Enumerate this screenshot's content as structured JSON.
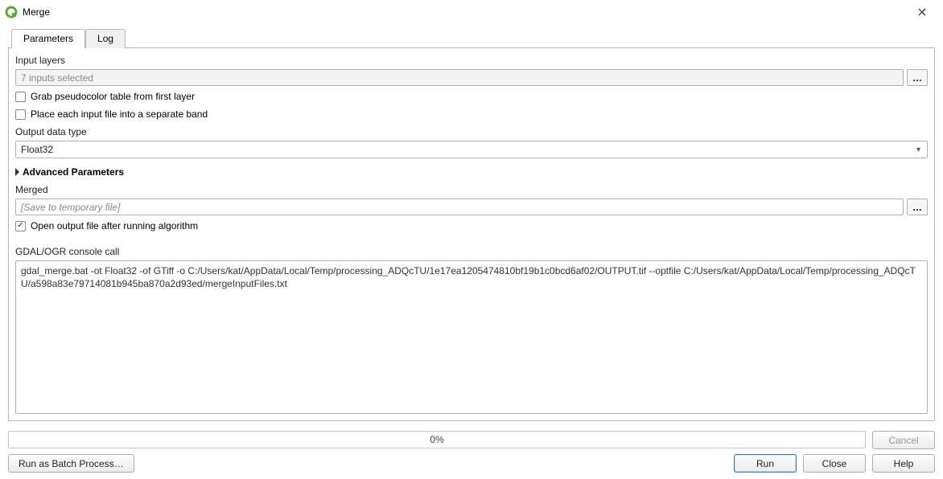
{
  "window": {
    "title": "Merge"
  },
  "tabs": {
    "parameters": "Parameters",
    "log": "Log",
    "active": "parameters"
  },
  "params": {
    "input_layers_label": "Input layers",
    "input_layers_value": "7 inputs selected",
    "browse_dots": "…",
    "grab_pseudo_label": "Grab pseudocolor table from first layer",
    "grab_pseudo_checked": false,
    "separate_band_label": "Place each input file into a separate band",
    "separate_band_checked": false,
    "output_type_label": "Output data type",
    "output_type_value": "Float32",
    "advanced_label": "Advanced Parameters",
    "merged_label": "Merged",
    "merged_placeholder": "[Save to temporary file]",
    "open_output_label": "Open output file after running algorithm",
    "open_output_checked": true,
    "console_label": "GDAL/OGR console call",
    "console_text": "gdal_merge.bat -ot Float32 -of GTiff -o C:/Users/kat/AppData/Local/Temp/processing_ADQcTU/1e17ea1205474810bf19b1c0bcd6af02/OUTPUT.tif --optfile C:/Users/kat/AppData/Local/Temp/processing_ADQcTU/a598a83e79714081b945ba870a2d93ed/mergeInputFiles.txt"
  },
  "bottom": {
    "progress_text": "0%",
    "cancel": "Cancel",
    "batch": "Run as Batch Process…",
    "run": "Run",
    "close": "Close",
    "help": "Help"
  }
}
